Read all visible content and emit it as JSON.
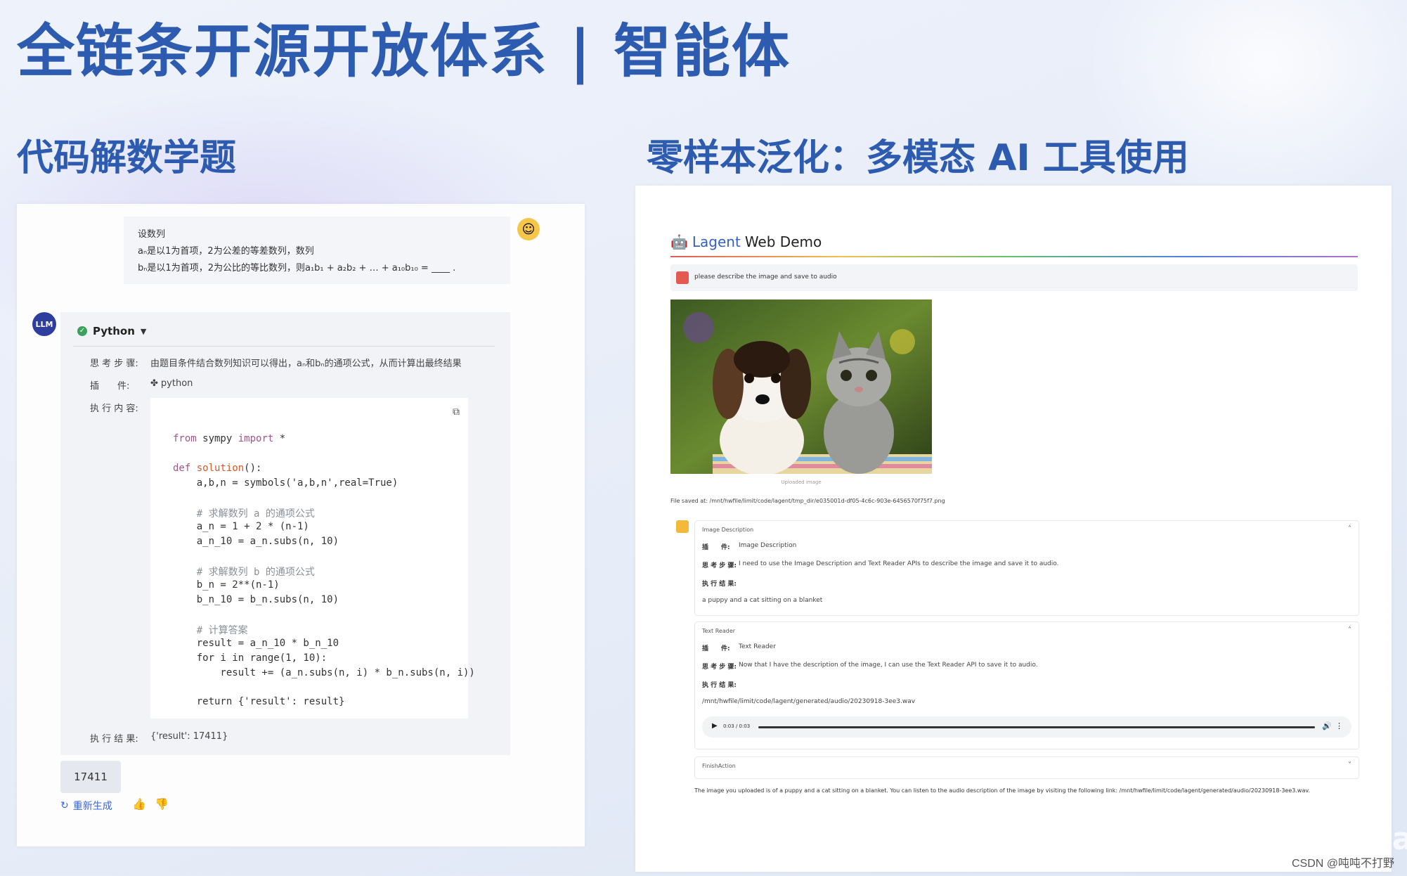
{
  "slide": {
    "title": "全链条开源开放体系 | 智能体",
    "left_heading": "代码解数学题",
    "right_heading": "零样本泛化：多模态 AI 工具使用",
    "watermark_csdn": "CSDN @吨吨不打野",
    "watermark_brand": "OpenMMLab"
  },
  "math_demo": {
    "question_line1": "设数列",
    "question_line2": "aₙ是以1为首项，2为公差的等差数列，数列",
    "question_line3": "bₙ是以1为首项，2为公比的等比数列，则a₁b₁ + a₂b₂ + … + a₁₀b₁₀ = ____ .",
    "llm_avatar": "LLM",
    "tool_status": "Python",
    "think_label": "思 考 步 骤:",
    "think_text": "由题目条件结合数列知识可以得出，aₙ和bₙ的通项公式，从而计算出最终结果",
    "plugin_label": "插　　件:",
    "plugin_value": "python",
    "exec_label": "执 行 内 容:",
    "code_lines": [
      "from sympy import *",
      "",
      "def solution():",
      "    a,b,n = symbols('a,b,n',real=True)",
      "",
      "    # 求解数列 a 的通项公式",
      "    a_n = 1 + 2 * (n-1)",
      "    a_n_10 = a_n.subs(n, 10)",
      "",
      "    # 求解数列 b 的通项公式",
      "    b_n = 2**(n-1)",
      "    b_n_10 = b_n.subs(n, 10)",
      "",
      "    # 计算答案",
      "    result = a_n_10 * b_n_10",
      "    for i in range(1, 10):",
      "        result += (a_n.subs(n, i) * b_n.subs(n, i))",
      "",
      "    return {'result': result}"
    ],
    "result_label": "执 行 结 果:",
    "result_value": "{'result': 17411}",
    "final_answer": "17411",
    "regenerate_label": "重新生成"
  },
  "lagent_demo": {
    "app_title_brand": "Lagent",
    "app_title_rest": "Web Demo",
    "user_prompt": "please describe the image and save to audio",
    "image_caption": "Uploaded image",
    "file_saved": "File saved at: /mnt/hwfile/limit/code/lagent/tmp_dir/e035001d-df05-4c6c-903e-6456570f75f7.png",
    "steps": [
      {
        "title": "Image Description",
        "tool_label": "插　　件:",
        "tool_value": "Image Description",
        "think_label": "思 考 步 骤:",
        "think_value": "I need to use the Image Description and Text Reader APIs to describe the image and save it to audio.",
        "result_label": "执 行 结 果:",
        "result_value": "a puppy and a cat sitting on a blanket"
      },
      {
        "title": "Text Reader",
        "tool_label": "插　　件:",
        "tool_value": "Text Reader",
        "think_label": "思 考 步 骤:",
        "think_value": "Now that I have the description of the image, I can use the Text Reader API to save it to audio.",
        "result_label": "执 行 结 果:",
        "result_value": "/mnt/hwfile/limit/code/lagent/generated/audio/20230918-3ee3.wav",
        "audio_time": "0:03 / 0:03"
      }
    ],
    "finish_title": "FinishAction",
    "final_text": "The image you uploaded is of a puppy and a cat sitting on a blanket. You can listen to the audio description of the image by visiting the following link: /mnt/hwfile/limit/code/lagent/generated/audio/20230918-3ee3.wav."
  }
}
